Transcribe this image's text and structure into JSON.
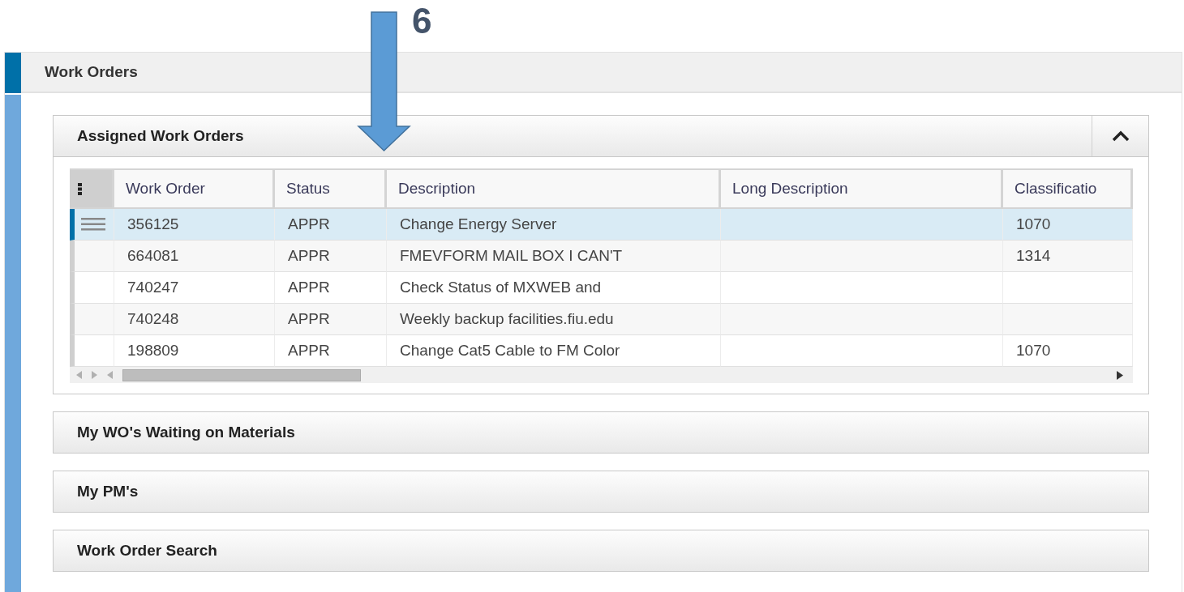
{
  "annotation": {
    "label": "6"
  },
  "section": {
    "title": "Work Orders"
  },
  "panels": [
    {
      "title": "Assigned Work Orders",
      "expanded": true,
      "table": {
        "columns": [
          "Work Order",
          "Status",
          "Description",
          "Long Description",
          "Classificatio"
        ],
        "rows": [
          {
            "work_order": "356125",
            "status": "APPR",
            "description": "Change Energy Server",
            "classification": "1070",
            "selected": true
          },
          {
            "work_order": "664081",
            "status": "APPR",
            "description": "FMEVFORM MAIL BOX I CAN'T",
            "classification": "1314",
            "selected": false
          },
          {
            "work_order": "740247",
            "status": "APPR",
            "description": "Check Status of MXWEB and",
            "selected": false
          },
          {
            "work_order": "740248",
            "status": "APPR",
            "description": "Weekly backup facilities.fiu.edu",
            "selected": false
          },
          {
            "work_order": "198809",
            "status": "APPR",
            "description": "Change Cat5 Cable to FM Color",
            "classification": "1070",
            "selected": false
          }
        ]
      }
    },
    {
      "title": "My WO's Waiting on Materials",
      "expanded": false
    },
    {
      "title": "My PM's",
      "expanded": false
    },
    {
      "title": "Work Order Search",
      "expanded": false
    }
  ]
}
